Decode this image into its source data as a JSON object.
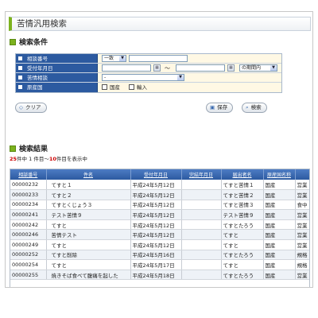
{
  "page_title": "苦情汎用検索",
  "search_section": {
    "title": "検索条件",
    "rows": [
      {
        "label": "相談番号",
        "match_select": "一致"
      },
      {
        "label": "受付年月日",
        "tilde": "～",
        "period_select": "の期間内"
      },
      {
        "label": "苦情相談",
        "value_select": "-"
      },
      {
        "label": "原産国",
        "checkbox1": "国産",
        "checkbox2": "輸入"
      }
    ]
  },
  "buttons": {
    "clear": "クリア",
    "save": "保存",
    "search": "検索"
  },
  "results_section": {
    "title": "検索結果",
    "total": "25",
    "count_mid": "件中 1 件目～",
    "count_end": "10",
    "count_suffix": "件目を表示中"
  },
  "table": {
    "headers": [
      "相談番号",
      "件名",
      "受付年月日",
      "完結年月日",
      "届出者名",
      "原産国名称",
      "苦情"
    ],
    "rows": [
      [
        "00000232",
        "てすと１",
        "平成24年5月12日",
        "",
        "てすと苦情１",
        "国産",
        "営業"
      ],
      [
        "00000233",
        "てすと２",
        "平成24年5月12日",
        "",
        "てすと苦情２",
        "国産",
        "営業"
      ],
      [
        "00000234",
        "てすとくじょう３",
        "平成24年5月12日",
        "",
        "てすと苦情３",
        "国産",
        "食中"
      ],
      [
        "00000241",
        "テスト苦情９",
        "平成24年5月12日",
        "",
        "テスト苦情９",
        "国産",
        "営業"
      ],
      [
        "00000242",
        "てすと",
        "平成24年5月12日",
        "",
        "てすとたろう",
        "国産",
        "営業"
      ],
      [
        "00000246",
        "苦情テスト",
        "平成24年5月12日",
        "",
        "てすと",
        "国産",
        "営業"
      ],
      [
        "00000249",
        "てすと",
        "平成24年5月12日",
        "",
        "てすと",
        "国産",
        "営業"
      ],
      [
        "00000252",
        "てすと削除",
        "平成24年5月16日",
        "",
        "てすとたろう",
        "国産",
        "規格"
      ],
      [
        "00000254",
        "てすと",
        "平成24年5月17日",
        "",
        "てすと",
        "国産",
        "規格"
      ],
      [
        "00000255",
        "焼きそば食べて腹痛を起した",
        "平成24年5月18日",
        "",
        "てすとたろう",
        "国産",
        "営業"
      ]
    ]
  }
}
